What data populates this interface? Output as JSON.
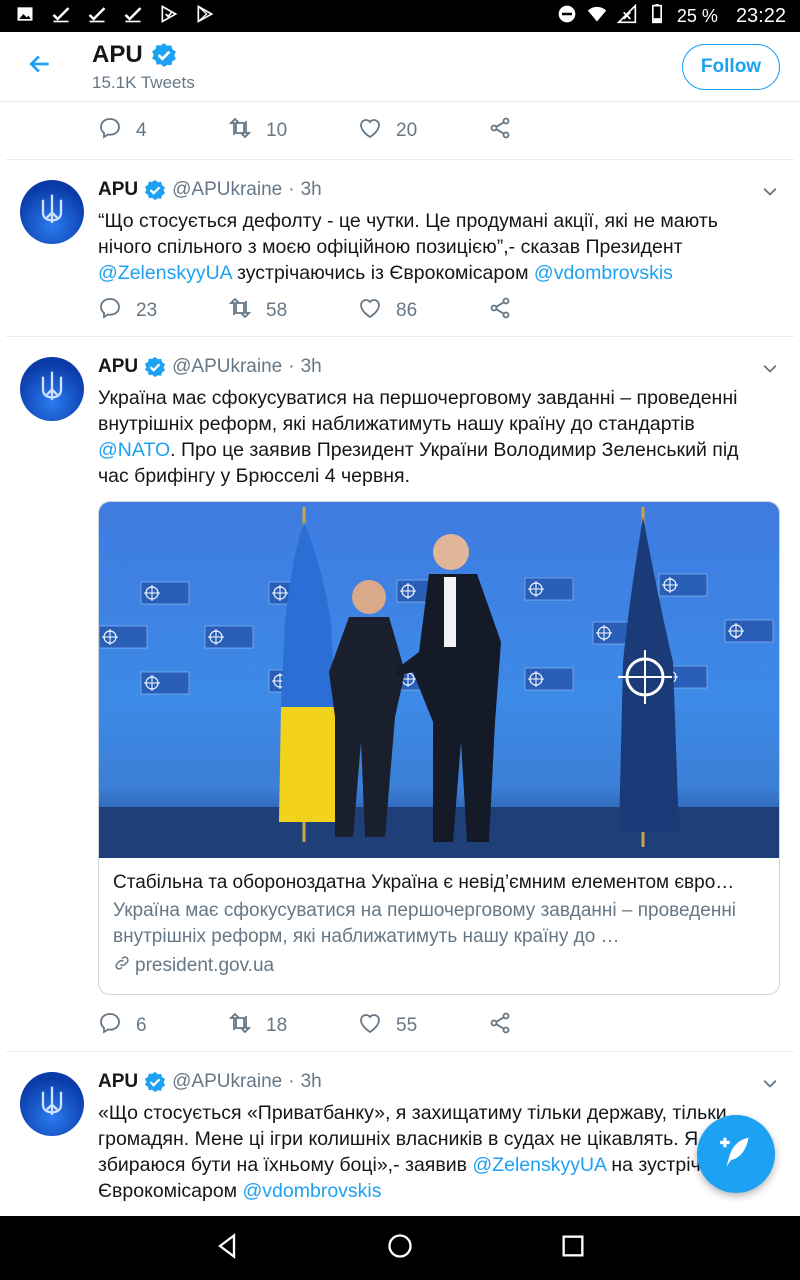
{
  "status_bar": {
    "battery": "25 %",
    "time": "23:22"
  },
  "header": {
    "title": "APU",
    "tweet_count": "15.1K Tweets",
    "follow_label": "Follow"
  },
  "top_actions": {
    "replies": "4",
    "retweets": "10",
    "likes": "20"
  },
  "tweets": [
    {
      "name": "APU",
      "handle": "@APUkraine",
      "dot": "·",
      "time": "3h",
      "text": [
        "“Що стосується дефолту - це чутки. Це продумані акції, які не мають нічого спільного з моєю офіційною позицією”,- сказав Президент ",
        "@ZelenskyyUA",
        " зустрічаючись із Єврокомісаром ",
        "@vdombrovskis"
      ],
      "replies": "23",
      "retweets": "58",
      "likes": "86"
    },
    {
      "name": "APU",
      "handle": "@APUkraine",
      "dot": "·",
      "time": "3h",
      "text": [
        "Україна має сфокусуватися на першочерговому завданні – проведенні внутрішніх реформ, які наближатимуть нашу країну до стандартів ",
        "@NATO",
        ". Про це заявив Президент України Володимир Зеленський під час брифінгу у Брюсселі 4 червня."
      ],
      "card": {
        "title": "Стабільна та обороноздатна Україна є невід’ємним елементом євро…",
        "description": "Україна має сфокусуватися на першочерговому завданні – проведенні внутрішніх реформ, які наближатимуть нашу країну до …",
        "domain": "president.gov.ua",
        "backdrop_label": "NATO OTAN"
      },
      "replies": "6",
      "retweets": "18",
      "likes": "55"
    },
    {
      "name": "APU",
      "handle": "@APUkraine",
      "dot": "·",
      "time": "3h",
      "text": [
        "«Що стосується «Приватбанку», я захищатиму тільки державу, тільки громадян. Мене ці ігри колишніх власників в судах не цікавлять. Я не збираюся бути на їхньому боці»,- заявив ",
        "@ZelenskyyUA",
        " на зустрічі з Єврокомісаром ",
        "@vdombrovskis"
      ]
    }
  ],
  "colors": {
    "accent": "#1da1f2",
    "secondary_text": "#657786",
    "divider": "#e6ecf0"
  }
}
